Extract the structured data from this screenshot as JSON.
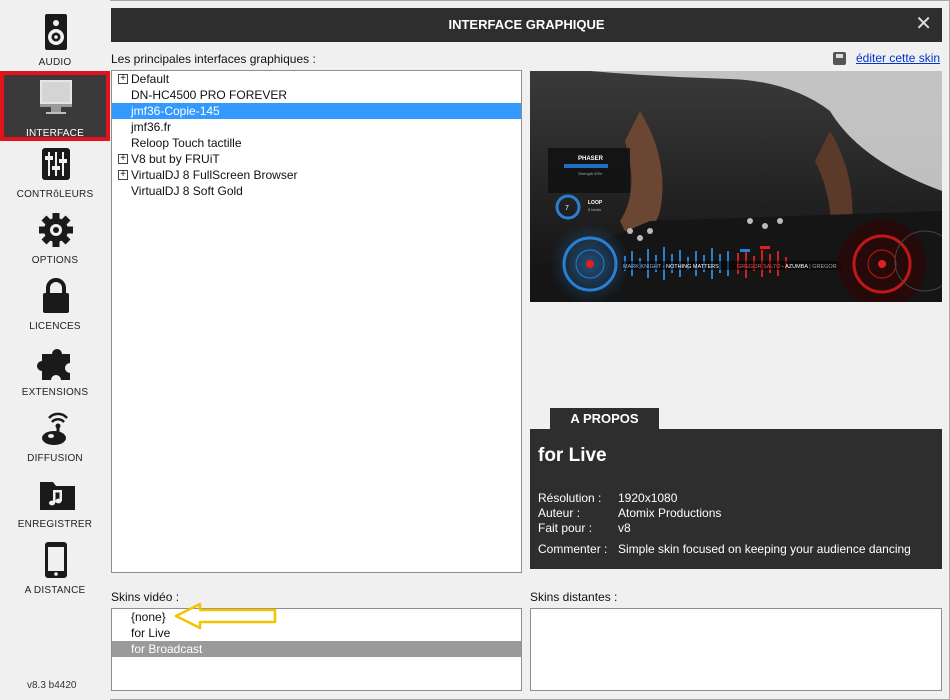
{
  "sidebar": {
    "items": [
      {
        "label": "AUDIO",
        "icon": "speaker-icon"
      },
      {
        "label": "INTERFACE",
        "icon": "monitor-icon"
      },
      {
        "label": "CONTRôLEURS",
        "icon": "sliders-icon"
      },
      {
        "label": "OPTIONS",
        "icon": "gear-icon"
      },
      {
        "label": "LICENCES",
        "icon": "lock-icon"
      },
      {
        "label": "EXTENSIONS",
        "icon": "puzzle-icon"
      },
      {
        "label": "DIFFUSION",
        "icon": "broadcast-icon"
      },
      {
        "label": "ENREGISTRER",
        "icon": "music-folder-icon"
      },
      {
        "label": "A DISTANCE",
        "icon": "phone-icon"
      }
    ],
    "active_index": 1,
    "version": "v8.3 b4420"
  },
  "window": {
    "title": "INTERFACE GRAPHIQUE",
    "close": "✕"
  },
  "skins": {
    "label": "Les principales interfaces graphiques :",
    "edit_link": "éditer cette skin",
    "items": [
      {
        "label": "Default",
        "expandable": true
      },
      {
        "label": "DN-HC4500 PRO FOREVER",
        "expandable": false
      },
      {
        "label": "jmf36-Copie-145",
        "expandable": false,
        "selected": true
      },
      {
        "label": "jmf36.fr",
        "expandable": false
      },
      {
        "label": "Reloop Touch tactille",
        "expandable": false
      },
      {
        "label": "V8 but by FRUiT",
        "expandable": true
      },
      {
        "label": "VirtualDJ 8 FullScreen Browser",
        "expandable": true
      },
      {
        "label": "VirtualDJ 8 Soft Gold",
        "expandable": false
      }
    ]
  },
  "preview": {
    "phaser_label": "PHASER",
    "phaser_sub": "Strength 63%",
    "loop_value": "7",
    "loop_label": "LOOP",
    "loop_sub": "8 beats",
    "track_left_artist": "MARK KNIGHT",
    "track_left_title": "NOTHING MATTERS",
    "track_right_artist": "GREGOR SALTO",
    "track_right_title": "AZUMBA",
    "track_right_extra": "GREGOR"
  },
  "about": {
    "tab": "A PROPOS",
    "name": "for Live",
    "rows": [
      {
        "key": "Résolution :",
        "value": "1920x1080"
      },
      {
        "key": "Auteur :",
        "value": "Atomix Productions"
      },
      {
        "key": "Fait pour :",
        "value": "v8"
      },
      {
        "key": "Commenter :",
        "value": "Simple skin focused on keeping your audience dancing"
      }
    ]
  },
  "video_skins": {
    "label": "Skins vidéo :",
    "items": [
      {
        "label": "{none}"
      },
      {
        "label": "for Live"
      },
      {
        "label": "for Broadcast",
        "highlighted": true
      }
    ]
  },
  "remote_skins": {
    "label": "Skins distantes :"
  },
  "colors": {
    "accent_blue": "#3399ff",
    "active_outline": "#e1141e",
    "annotation_arrow": "#f5c400",
    "dark_panel": "#2e2e2e"
  }
}
